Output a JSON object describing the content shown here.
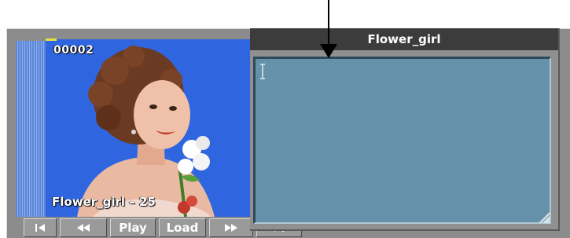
{
  "clip": {
    "frame_counter": "00002",
    "caption": "Flower_girl – 25"
  },
  "transport": {
    "start_icon": "skip-to-start-icon",
    "rewind_icon": "rewind-icon",
    "play_label": "Play",
    "load_label": "Load",
    "forward_icon": "fast-forward-icon",
    "end_icon": "skip-to-end-icon"
  },
  "notes_panel": {
    "title": "Flower_girl"
  },
  "colors": {
    "frame": "#8c8c8c",
    "title_bar": "#3c3c3c",
    "notes_bg": "#6592aa",
    "thumb_bg": "#2f66e0"
  }
}
